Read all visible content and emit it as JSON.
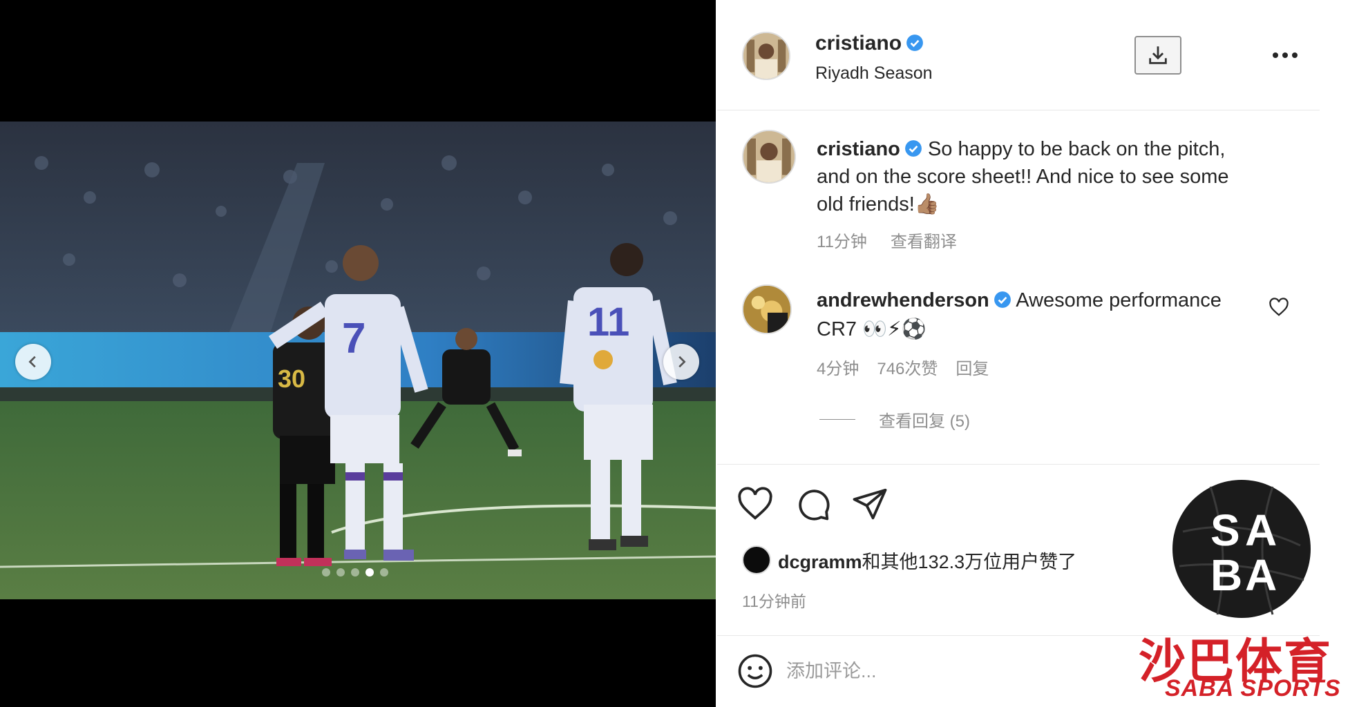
{
  "post": {
    "username": "cristiano",
    "location": "Riyadh Season"
  },
  "caption": {
    "username": "cristiano",
    "text": "So happy to be back on the pitch, and on the score sheet!! And nice to see some old friends!👍🏽",
    "time": "11分钟",
    "translate": "查看翻译"
  },
  "comment": {
    "username": "andrewhenderson",
    "text": "Awesome performance CR7 👀⚡⚽",
    "time": "4分钟",
    "likes": "746次赞",
    "reply": "回复",
    "view_replies": "查看回复 (5)"
  },
  "likes": {
    "user": "dcgramm",
    "others": "和其他132.3万位用户赞了"
  },
  "post_time": "11分钟前",
  "comment_box": {
    "placeholder": "添加评论..."
  },
  "carousel": {
    "total": 5,
    "active": 4
  },
  "jerseys": {
    "player_left": "30",
    "player_center": "7",
    "player_right": "11"
  },
  "watermark": {
    "logo_text": "SABA",
    "cn": "沙巴体育",
    "en": "SABA SPORTS"
  },
  "icons": {
    "prev": "chevron-left-icon",
    "next": "chevron-right-icon",
    "download": "download-icon",
    "more": "more-icon",
    "like": "heart-icon",
    "comment": "comment-bubble-icon",
    "share": "paper-plane-icon",
    "emoji": "smiley-icon",
    "verified": "verified-badge-icon"
  },
  "colors": {
    "verified": "#3897f0",
    "watermark_red": "#d42128"
  }
}
